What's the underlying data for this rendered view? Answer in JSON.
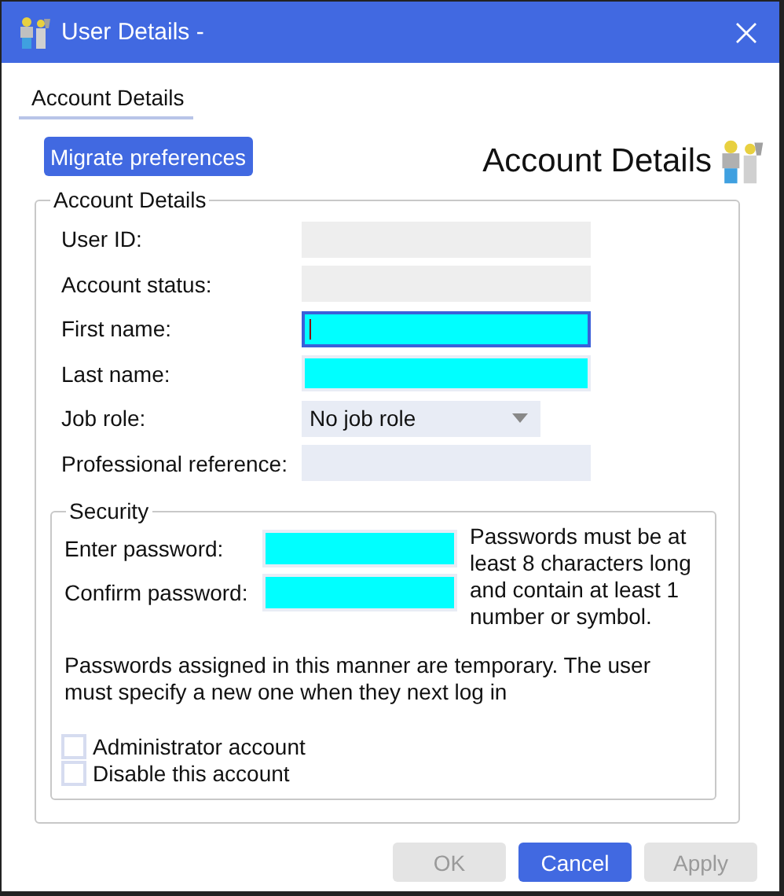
{
  "window": {
    "title": "User Details -"
  },
  "tabs": [
    {
      "label": "Account Details",
      "selected": true
    }
  ],
  "migrate_button": {
    "label": "Migrate preferences"
  },
  "header": {
    "title": "Account Details"
  },
  "account_group": {
    "legend": "Account Details",
    "fields": [
      {
        "label": "User ID:",
        "kind": "readonly",
        "focused": false
      },
      {
        "label": "Account status:",
        "kind": "readonly",
        "focused": false
      },
      {
        "label": "First name:",
        "kind": "required",
        "focused": true
      },
      {
        "label": "Last name:",
        "kind": "required",
        "focused": false
      },
      {
        "label": "Job role:",
        "kind": "select",
        "value": "No job role",
        "focused": false
      },
      {
        "label": "Professional reference:",
        "kind": "text",
        "focused": false
      }
    ]
  },
  "security_group": {
    "legend": "Security",
    "fields": [
      {
        "label": "Enter password:",
        "kind": "required"
      },
      {
        "label": "Confirm password:",
        "kind": "required"
      }
    ],
    "rule_note": "Passwords must be at least 8 characters long and contain at least 1 number or symbol.",
    "temp_note": "Passwords assigned in this manner are temporary. The user must specify a new one when they next log in",
    "checkboxes": [
      {
        "label": "Administrator account",
        "checked": false
      },
      {
        "label": "Disable this account",
        "checked": false
      }
    ]
  },
  "buttons": [
    {
      "label": "OK",
      "disabled": true,
      "default": false
    },
    {
      "label": "Cancel",
      "disabled": false,
      "default": true
    },
    {
      "label": "Apply",
      "disabled": true,
      "default": false
    }
  ]
}
